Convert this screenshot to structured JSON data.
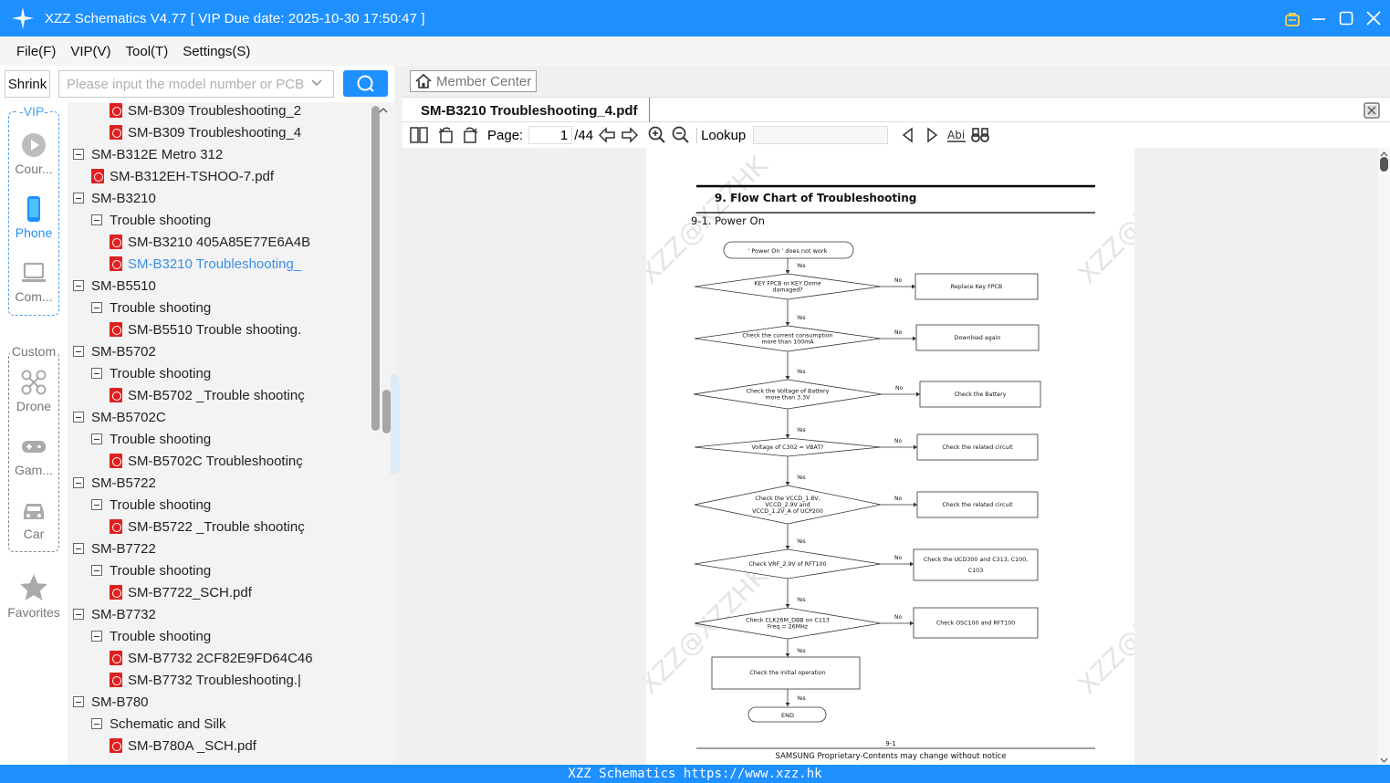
{
  "window": {
    "title": "XZZ Schematics V4.77 [ VIP Due date: 2025-10-30 17:50:47 ]"
  },
  "menu": [
    "File(F)",
    "VIP(V)",
    "Tool(T)",
    "Settings(S)"
  ],
  "toolbar": {
    "shrink_label": "Shrink",
    "search_placeholder": "Please input the model number or PCB"
  },
  "sidebar": {
    "vip_label": "-VIP-",
    "custom_label": "Custom",
    "items": [
      {
        "label": "Cour...",
        "icon": "play-circle-icon",
        "active": false
      },
      {
        "label": "Phone",
        "icon": "phone-icon",
        "active": true
      },
      {
        "label": "Com...",
        "icon": "laptop-icon",
        "active": false
      },
      {
        "label": "Drone",
        "icon": "drone-icon",
        "active": false
      },
      {
        "label": "Gam...",
        "icon": "gamepad-icon",
        "active": false
      },
      {
        "label": "Car",
        "icon": "car-icon",
        "active": false
      },
      {
        "label": "Favorites",
        "icon": "star-icon",
        "active": false
      }
    ]
  },
  "tree": [
    {
      "level": 2,
      "type": "pdf",
      "label": "SM-B309 Troubleshooting_2"
    },
    {
      "level": 2,
      "type": "pdf",
      "label": "SM-B309 Troubleshooting_4"
    },
    {
      "level": 0,
      "type": "folder",
      "label": "SM-B312E Metro 312"
    },
    {
      "level": 1,
      "type": "pdf",
      "label": "SM-B312EH-TSHOO-7.pdf"
    },
    {
      "level": 0,
      "type": "folder",
      "label": "SM-B3210"
    },
    {
      "level": 1,
      "type": "folder",
      "label": "Trouble shooting"
    },
    {
      "level": 2,
      "type": "pdf",
      "label": "SM-B3210 405A85E77E6A4B"
    },
    {
      "level": 2,
      "type": "pdf",
      "label": "SM-B3210 Troubleshooting_",
      "selected": true
    },
    {
      "level": 0,
      "type": "folder",
      "label": "SM-B5510"
    },
    {
      "level": 1,
      "type": "folder",
      "label": "Trouble shooting"
    },
    {
      "level": 2,
      "type": "pdf",
      "label": "SM-B5510 Trouble shooting."
    },
    {
      "level": 0,
      "type": "folder",
      "label": "SM-B5702"
    },
    {
      "level": 1,
      "type": "folder",
      "label": "Trouble shooting"
    },
    {
      "level": 2,
      "type": "pdf",
      "label": "SM-B5702 _Trouble shootinç"
    },
    {
      "level": 0,
      "type": "folder",
      "label": "SM-B5702C"
    },
    {
      "level": 1,
      "type": "folder",
      "label": "Trouble shooting"
    },
    {
      "level": 2,
      "type": "pdf",
      "label": "SM-B5702C Troubleshootinç"
    },
    {
      "level": 0,
      "type": "folder",
      "label": "SM-B5722"
    },
    {
      "level": 1,
      "type": "folder",
      "label": "Trouble shooting"
    },
    {
      "level": 2,
      "type": "pdf",
      "label": "SM-B5722 _Trouble shootinç"
    },
    {
      "level": 0,
      "type": "folder",
      "label": "SM-B7722"
    },
    {
      "level": 1,
      "type": "folder",
      "label": "Trouble shooting"
    },
    {
      "level": 2,
      "type": "pdf",
      "label": "SM-B7722_SCH.pdf"
    },
    {
      "level": 0,
      "type": "folder",
      "label": "SM-B7732"
    },
    {
      "level": 1,
      "type": "folder",
      "label": "Trouble shooting"
    },
    {
      "level": 2,
      "type": "pdf",
      "label": "SM-B7732 2CF82E9FD64C46"
    },
    {
      "level": 2,
      "type": "pdf",
      "label": "SM-B7732 Troubleshooting.|"
    },
    {
      "level": 0,
      "type": "folder",
      "label": "SM-B780"
    },
    {
      "level": 1,
      "type": "folder",
      "label": "Schematic and Silk"
    },
    {
      "level": 2,
      "type": "pdf",
      "label": "SM-B780A _SCH.pdf"
    }
  ],
  "right": {
    "member_center": "Member Center",
    "tab_title": "SM-B3210 Troubleshooting_4.pdf",
    "page_label": "Page:",
    "page_current": "1",
    "page_total": "/44",
    "lookup_label": "Lookup"
  },
  "pdf": {
    "heading": "9.  Flow  Chart  of  Troubleshooting",
    "subheading": "9-1.  Power  On",
    "watermark": "XZZ@XZZHK",
    "start": "' Power On ' does not work",
    "decisions": [
      {
        "text": [
          "KEY FPCB or KEY Dome",
          "damaged?"
        ],
        "yes_label": "Yes",
        "no_label": "No",
        "action": [
          "Replace Key FPCB"
        ]
      },
      {
        "text": [
          "Check  the  current  consumption",
          "more  than  100mA"
        ],
        "yes_label": "Yes",
        "no_label": "No",
        "action": [
          "Download again"
        ]
      },
      {
        "text": [
          "Check  the  Voltage  of  Battery",
          "more  than  3.3V"
        ],
        "yes_label": "Yes",
        "no_label": "No",
        "action": [
          "Check  the  Battery"
        ]
      },
      {
        "text": [
          "Voltage  of  C302  =  VBAT?"
        ],
        "yes_label": "Yes",
        "no_label": "No",
        "action": [
          "Check  the  related  circuit"
        ]
      },
      {
        "text": [
          "Check  the  VCCD_1.8V,",
          "VCCD_2.9V  and",
          "VCCD_1.2V_A  of  UCP200"
        ],
        "yes_label": "Yes",
        "no_label": "No",
        "action": [
          "Check  the  related  circuit"
        ]
      },
      {
        "text": [
          "Check  VRF_2.9V  of  RFT100"
        ],
        "yes_label": "Yes",
        "no_label": "No",
        "action": [
          "Check  the  UCD300  and  C313,  C100,",
          "C103"
        ]
      },
      {
        "text": [
          "Check  CLK26M_DBB  on  C113",
          "Freq  =  26MHz"
        ],
        "yes_label": "Yes",
        "no_label": "No",
        "action": [
          "Check  OSC100  and  RFT100"
        ]
      }
    ],
    "final_action": "Check  the  initial  operation",
    "final_yes": "Yes",
    "end": "END",
    "footer_page": "9-1",
    "footer_text": "SAMSUNG Proprietary-Contents may change without notice"
  },
  "status": {
    "text": "XZZ Schematics https://www.xzz.hk"
  }
}
